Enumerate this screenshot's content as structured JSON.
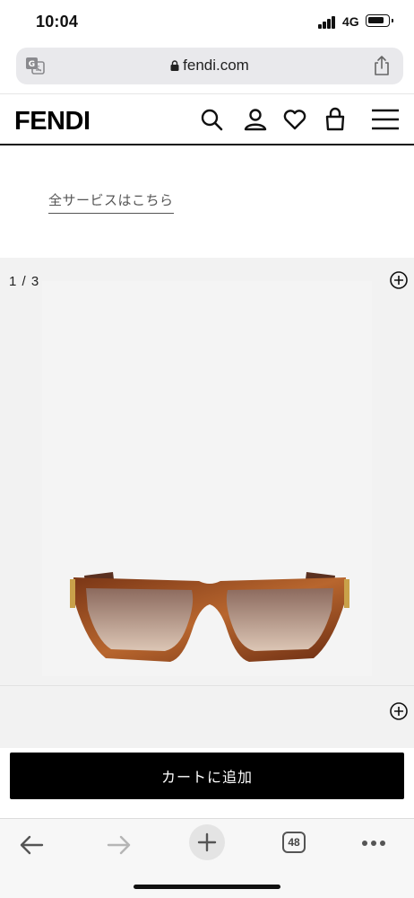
{
  "status_bar": {
    "time": "10:04",
    "network": "4G"
  },
  "browser": {
    "url": "fendi.com",
    "tab_count": "48",
    "icons": [
      "translate-icon",
      "lock-icon",
      "share-icon",
      "back-arrow-icon",
      "forward-arrow-icon",
      "plus-icon",
      "tabs-icon",
      "more-icon"
    ]
  },
  "site_header": {
    "logo": "FENDI",
    "icons": [
      "search-icon",
      "user-icon",
      "heart-icon",
      "bag-icon",
      "menu-icon"
    ]
  },
  "services_link": "全サービスはこちら",
  "gallery": {
    "page_counter": "1 / 3",
    "icons": [
      "zoom-plus-icon"
    ]
  },
  "cart": {
    "button_label": "カートに追加"
  },
  "colors": {
    "accent": "#000000",
    "gallery_bg": "#f2f2f2",
    "frame": "#9a4a22",
    "lens": "#b08a78"
  }
}
